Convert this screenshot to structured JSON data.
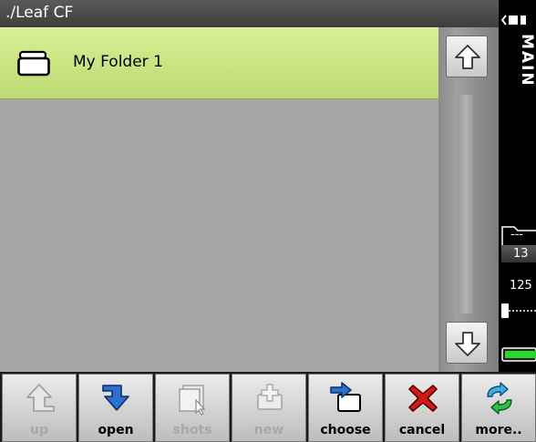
{
  "window": {
    "path": "./Leaf CF"
  },
  "filelist": {
    "items": [
      {
        "label": "My Folder 1",
        "icon": "folder-icon"
      }
    ]
  },
  "sidebar": {
    "main_label": "MAIN",
    "folder_count_top": "---",
    "folder_count": "13",
    "shutter_speed": "125"
  },
  "toolbar": {
    "buttons": [
      {
        "label": "up",
        "icon": "up-arrow-icon",
        "enabled": false
      },
      {
        "label": "open",
        "icon": "open-arrow-icon",
        "enabled": true
      },
      {
        "label": "shots",
        "icon": "shots-icon",
        "enabled": false
      },
      {
        "label": "new",
        "icon": "new-folder-icon",
        "enabled": false
      },
      {
        "label": "choose",
        "icon": "choose-icon",
        "enabled": true
      },
      {
        "label": "cancel",
        "icon": "cancel-x-icon",
        "enabled": true
      },
      {
        "label": "more..",
        "icon": "refresh-arrows-icon",
        "enabled": true
      }
    ]
  },
  "colors": {
    "selected_row": "#c8e283",
    "list_background": "#a6a6a6",
    "accent_blue": "#2f6fd0",
    "cancel_red": "#d11a1a",
    "battery_green": "#2bd62b"
  }
}
